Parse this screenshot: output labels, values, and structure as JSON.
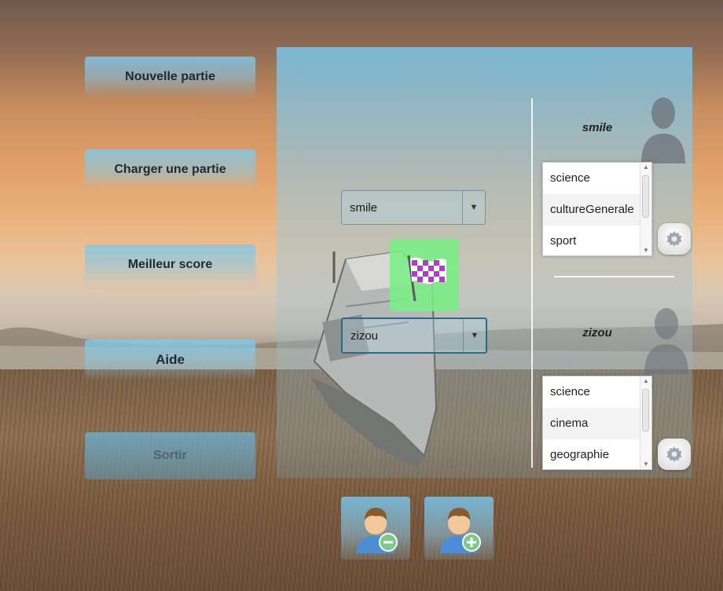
{
  "menu": {
    "new_game": "Nouvelle partie",
    "load_game": "Charger une partie",
    "best_score": "Meilleur score",
    "help": "Aide",
    "quit": "Sortir"
  },
  "player_selectors": {
    "player1_value": "smile",
    "player2_value": "zizou"
  },
  "players": [
    {
      "name": "smile",
      "themes": [
        "science",
        "cultureGenerale",
        "sport"
      ]
    },
    {
      "name": "zizou",
      "themes": [
        "science",
        "cinema",
        "geographie"
      ]
    }
  ],
  "icons": {
    "start": "checkered-flag-icon",
    "settings": "gear-icon",
    "avatar": "user-silhouette-icon",
    "remove_player": "user-remove-icon",
    "add_player": "user-add-icon"
  },
  "colors": {
    "menu_button": "#8cc8e0",
    "start_tile": "#78f082",
    "flag_checker": "#b03cc8"
  }
}
